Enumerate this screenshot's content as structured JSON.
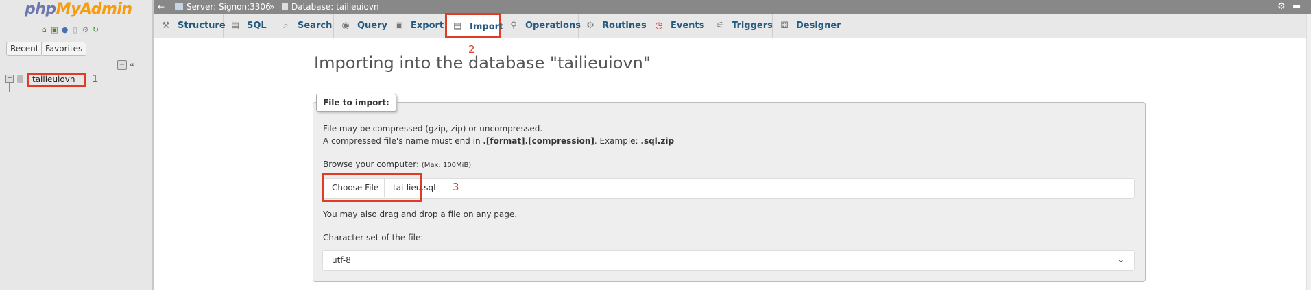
{
  "sidebar": {
    "logo_part1": "php",
    "logo_part2": "MyAdmin",
    "icons": [
      "home-icon",
      "exit-icon",
      "help-icon",
      "docs-icon",
      "settings-icon",
      "reload-icon"
    ],
    "recent_label": "Recent",
    "favorites_label": "Favorites",
    "collapse_symbol": "−",
    "database_item": "tailieuiovn",
    "annotation_1": "1"
  },
  "topbar": {
    "back_symbol": "←",
    "server": "Server: Signon:3306",
    "separator": "»",
    "database": "Database: tailieuiovn"
  },
  "tabs": [
    {
      "label": "Structure",
      "icon": "structure-icon"
    },
    {
      "label": "SQL",
      "icon": "sql-icon"
    },
    {
      "label": "Search",
      "icon": "search-icon"
    },
    {
      "label": "Query",
      "icon": "query-icon"
    },
    {
      "label": "Export",
      "icon": "export-icon"
    },
    {
      "label": "Import",
      "icon": "import-icon",
      "active": true
    },
    {
      "label": "Operations",
      "icon": "operations-icon"
    },
    {
      "label": "Routines",
      "icon": "routines-icon"
    },
    {
      "label": "Events",
      "icon": "events-icon"
    },
    {
      "label": "Triggers",
      "icon": "triggers-icon"
    },
    {
      "label": "Designer",
      "icon": "designer-icon"
    }
  ],
  "annotation_2": "2",
  "main": {
    "heading": "Importing into the database \"tailieuiovn\"",
    "legend": "File to import:",
    "compress_note": "File may be compressed (gzip, zip) or uncompressed.",
    "ext_note_prefix": "A compressed file's name must end in ",
    "ext_note_format": ".[format].[compression]",
    "ext_note_mid": ". Example: ",
    "ext_note_example": ".sql.zip",
    "browse_label": "Browse your computer: ",
    "browse_max": "(Max: 100MiB)",
    "choose_file_label": "Choose File",
    "file_name": "tai-lieu.sql",
    "annotation_3": "3",
    "drag_note": "You may also drag and drop a file on any page.",
    "charset_label": "Character set of the file:",
    "charset_value": "utf-8"
  },
  "colors": {
    "annotation": "#e03b24",
    "tab_text": "#235a81",
    "logo_php": "#6c78af",
    "logo_admin": "#f89c0e"
  }
}
